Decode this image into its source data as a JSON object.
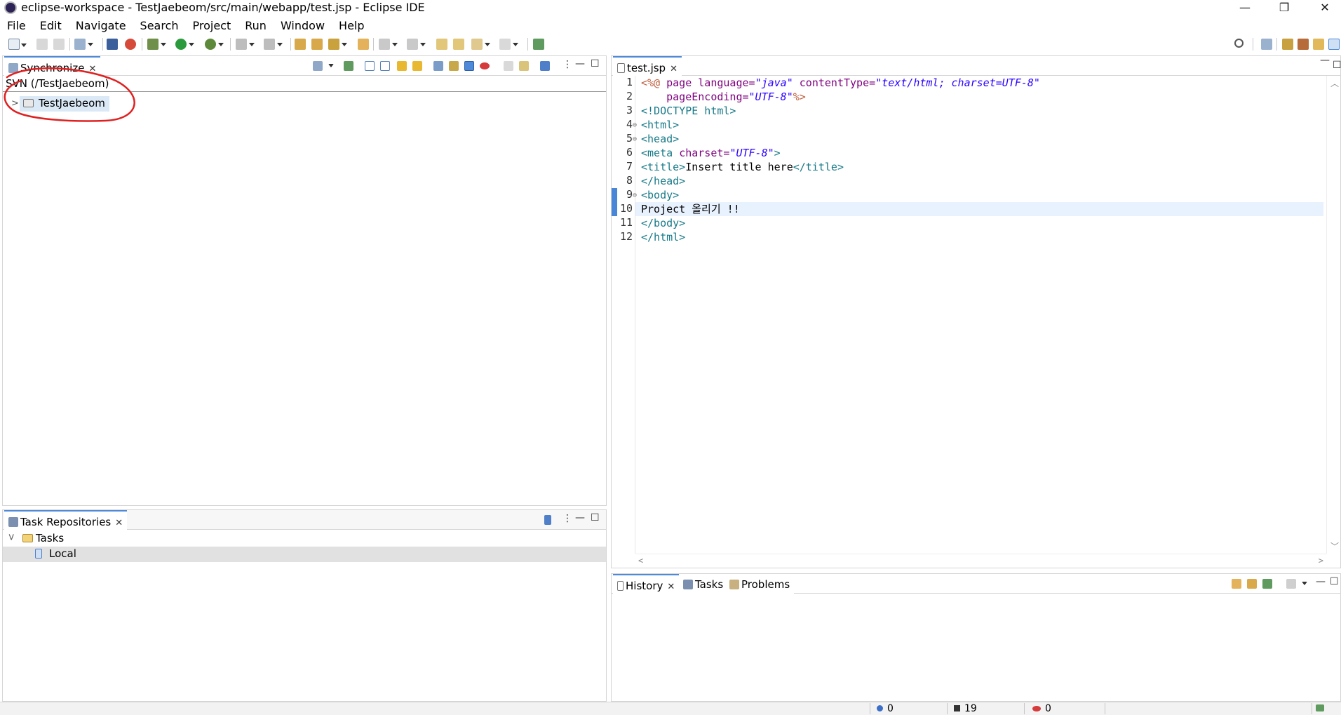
{
  "window": {
    "title": "eclipse-workspace - TestJaebeom/src/main/webapp/test.jsp - Eclipse IDE",
    "controls": {
      "minimize": "—",
      "restore": "❐",
      "close": "✕"
    }
  },
  "menu": [
    "File",
    "Edit",
    "Navigate",
    "Search",
    "Project",
    "Run",
    "Window",
    "Help"
  ],
  "synchronize": {
    "tab_label": "Synchronize",
    "header": "SVN (/TestJaebeom)",
    "tree_item": "TestJaebeom"
  },
  "task_repositories": {
    "tab_label": "Task Repositories",
    "group": "Tasks",
    "item": "Local"
  },
  "editor": {
    "tab_label": "test.jsp",
    "line_numbers": [
      "1",
      "2",
      "3",
      "4",
      "5",
      "6",
      "7",
      "8",
      "9",
      "10",
      "11",
      "12"
    ],
    "current_line": 10,
    "code": {
      "l1_a": "<%@ ",
      "l1_b": "page ",
      "l1_c": "language=",
      "l1_d": "\"java\"",
      "l1_e": " contentType=",
      "l1_f": "\"text/html; charset=UTF-8\"",
      "l2_a": "    pageEncoding=",
      "l2_b": "\"UTF-8\"",
      "l2_c": "%>",
      "l3": "<!DOCTYPE html>",
      "l4": "<html>",
      "l5": "<head>",
      "l6_a": "<meta ",
      "l6_b": "charset=",
      "l6_c": "\"UTF-8\"",
      "l6_d": ">",
      "l7_a": "<title>",
      "l7_b": "Insert title here",
      "l7_c": "</title>",
      "l8": "</head>",
      "l9": "<body>",
      "l10": "Project 올리기 !!",
      "l11": "</body>",
      "l12": "</html>"
    }
  },
  "bottom_panel": {
    "tabs": [
      "History",
      "Tasks",
      "Problems"
    ]
  },
  "status": {
    "info_count": "0",
    "warning_count": "19",
    "error_count": "0"
  },
  "colors": {
    "accent": "#4e8ad8",
    "annotation": "#e02020"
  }
}
